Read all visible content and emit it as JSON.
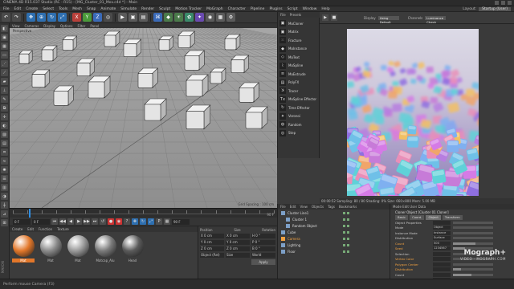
{
  "window": {
    "title": "CINEMA 4D R15.037 Studio (RC - R15) - [MG_Cluster_01_Mov.c4d *] - Main"
  },
  "menubar": {
    "items": [
      "File",
      "Edit",
      "Create",
      "Select",
      "Tools",
      "Mesh",
      "Snap",
      "Animate",
      "Simulate",
      "Render",
      "Sculpt",
      "Motion Tracker",
      "MoGraph",
      "Character",
      "Pipeline",
      "Plugins",
      "Script",
      "Window",
      "Help"
    ],
    "layout_label": "Layout:",
    "layout_value": "Startup (User)"
  },
  "viewport": {
    "menu": [
      "View",
      "Cameras",
      "Display",
      "Options",
      "Filter",
      "Panel"
    ],
    "label": "Perspective",
    "grid_spacing": "Grid Spacing : 100 cm"
  },
  "timeline": {
    "start_frame": "0 F",
    "end_frame": "90 F",
    "current_frame": "0 F",
    "playhead_fraction": 0.06
  },
  "materials": {
    "menu": [
      "Create",
      "Edit",
      "Function",
      "Texture"
    ],
    "items": [
      {
        "name": "Mat",
        "color": "#e2772a",
        "selected": true
      },
      {
        "name": "Mat",
        "color": "#8a8a8a",
        "selected": false
      },
      {
        "name": "Mat",
        "color": "#9a9a9a",
        "selected": false
      },
      {
        "name": "Matcap_Alu",
        "color": "#7a7a7a",
        "selected": false
      },
      {
        "name": "Head",
        "color": "#5a5a5a",
        "selected": false
      }
    ]
  },
  "coordinates": {
    "headers": [
      "Position",
      "Size",
      "Rotation"
    ],
    "rows": [
      [
        "X 0 cm",
        "X 0 cm",
        "H 0 °"
      ],
      [
        "Y 0 cm",
        "Y 0 cm",
        "P 0 °"
      ],
      [
        "Z 0 cm",
        "Z 0 cm",
        "B 0 °"
      ],
      [
        "Object (Rel)",
        "Size",
        "World"
      ]
    ],
    "apply_label": "Apply"
  },
  "palette": {
    "header": [
      "File",
      "Presets"
    ],
    "items": [
      {
        "icon": "▣",
        "label": "MoCloner"
      },
      {
        "icon": "▣",
        "label": "Matrix"
      },
      {
        "icon": "⁙",
        "label": "Fracture"
      },
      {
        "icon": "◆",
        "label": "MoInstance"
      },
      {
        "icon": "◇",
        "label": "MoText"
      },
      {
        "icon": "⌇",
        "label": "MoSpline"
      },
      {
        "icon": "≡",
        "label": "MoExtrude"
      },
      {
        "icon": "▤",
        "label": "PolyFX"
      },
      {
        "icon": "ꓘ",
        "label": "Tracer"
      },
      {
        "icon": "Tx",
        "label": "MoSpline Effector"
      },
      {
        "icon": "↻",
        "label": "Time Effector"
      },
      {
        "icon": "✦",
        "label": "Voronoi"
      },
      {
        "icon": "◍",
        "label": "Random"
      },
      {
        "icon": "◎",
        "label": "Step"
      }
    ]
  },
  "picture_viewer": {
    "display_label": "Display",
    "display_value": "Using Default",
    "channel_label": "Channels",
    "channel_value": "Luminance Check",
    "status": "00:00:52  Sampling: 80 / 80  Shading: 0%  Size: 660×800  Mem: 5.00 MB"
  },
  "objects": {
    "tabs": [
      "File",
      "Edit",
      "View",
      "Objects",
      "Tags",
      "Bookmarks"
    ],
    "rows": [
      {
        "label": "Cluster Line1",
        "selected": false
      },
      {
        "label": "Cluster 1",
        "selected": false
      },
      {
        "label": "Random Object",
        "selected": false
      },
      {
        "label": "Cube",
        "selected": false
      },
      {
        "label": "Camera",
        "selected": true
      },
      {
        "label": "Lighting",
        "selected": false
      },
      {
        "label": "Floor",
        "selected": false
      }
    ]
  },
  "attributes": {
    "header": "Mode  Edit  User Data",
    "title": "Cloner Object [Cluster 01 Cloner]",
    "tabs": [
      "Basic",
      "Coord.",
      "Object",
      "Transform"
    ],
    "rows": [
      {
        "key": "Object Properties",
        "value": "",
        "fill": 0,
        "orange": false
      },
      {
        "key": "Mode",
        "value": "Object",
        "fill": 0.0,
        "orange": false
      },
      {
        "key": "Instance Mode",
        "value": "Instance",
        "fill": 0.0,
        "orange": false
      },
      {
        "key": "Distribution",
        "value": "Surface",
        "fill": 0.0,
        "orange": false
      },
      {
        "key": "Count",
        "value": "500",
        "fill": 0.55,
        "orange": true
      },
      {
        "key": "Seed",
        "value": "1234567",
        "fill": 0.3,
        "orange": true
      },
      {
        "key": "Selection",
        "value": "",
        "fill": 0.0,
        "orange": false
      },
      {
        "key": "Vertex Color",
        "value": "",
        "fill": 0.0,
        "orange": true
      },
      {
        "key": "Polygon Center",
        "value": "",
        "fill": 0.0,
        "orange": true
      },
      {
        "key": "Distribution",
        "value": "",
        "fill": 0.2,
        "orange": true
      },
      {
        "key": "Count",
        "value": "",
        "fill": 0.45,
        "orange": false
      },
      {
        "key": "Surface",
        "value": "",
        "fill": 0.25,
        "orange": false
      }
    ],
    "watermark_line1": "Mograph+",
    "watermark_line2": "VIDEO · MOGRAPH.COM"
  },
  "statusbar": {
    "text": "Perform mouse Camera (F3)"
  },
  "toolbar": {
    "buttons": [
      "↶",
      "↷",
      "✥",
      "⊕",
      "↻",
      "⤢",
      "X",
      "Y",
      "Z",
      "◎",
      "▶",
      "▣",
      "▤",
      "⌘",
      "◆",
      "☀",
      "✿",
      "✦",
      "◉",
      "▦",
      "⚙"
    ]
  },
  "colors": {
    "accent": "#e2772a",
    "playhead": "#2e8fe6",
    "selected_object": "#f0a040"
  }
}
